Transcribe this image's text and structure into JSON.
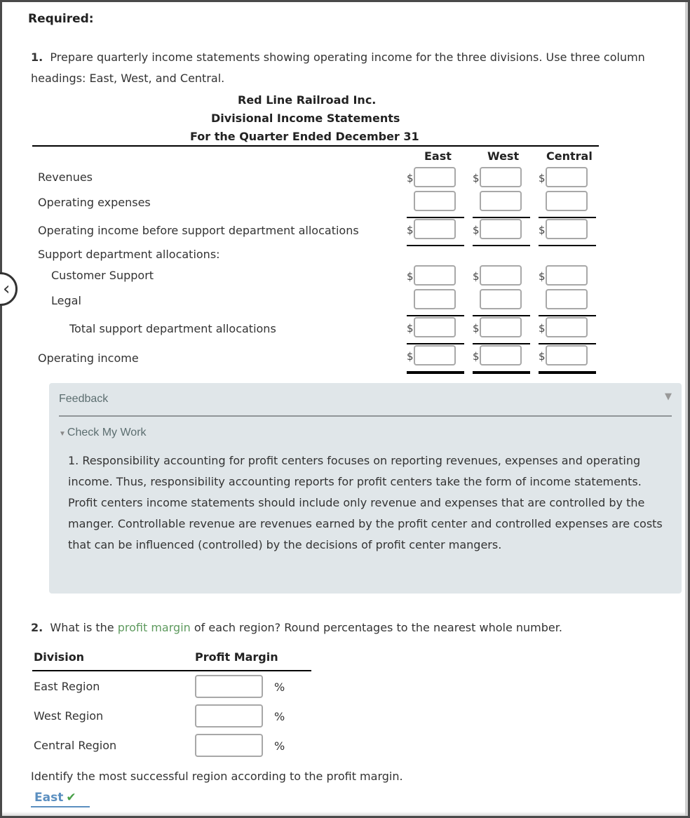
{
  "required_label": "Required:",
  "q1": {
    "number": "1.",
    "text": "Prepare quarterly income statements showing operating income for the three divisions. Use three column headings: East, West, and Central."
  },
  "statement": {
    "company": "Red Line Railroad Inc.",
    "title": "Divisional Income Statements",
    "period": "For the Quarter Ended December 31",
    "columns": [
      "East",
      "West",
      "Central"
    ],
    "currency_symbol": "$",
    "rows": [
      {
        "label": "Revenues",
        "values": [
          "",
          "",
          ""
        ]
      },
      {
        "label": "Operating expenses",
        "values": [
          "",
          "",
          ""
        ]
      },
      {
        "label": "Operating income before support department allocations",
        "values": [
          "",
          "",
          ""
        ]
      },
      {
        "label": "Support department allocations:"
      },
      {
        "label": "Customer Support",
        "values": [
          "",
          "",
          ""
        ]
      },
      {
        "label": "Legal",
        "values": [
          "",
          "",
          ""
        ]
      },
      {
        "label": "Total support department allocations",
        "values": [
          "",
          "",
          ""
        ]
      },
      {
        "label": "Operating income",
        "values": [
          "",
          "",
          ""
        ]
      }
    ]
  },
  "feedback": {
    "title": "Feedback",
    "check_my_work": "Check My Work",
    "text": "1. Responsibility accounting for profit centers focuses on reporting revenues, expenses and operating income. Thus, responsibility accounting reports for profit centers take the form of income statements. Profit centers income statements should include only revenue and expenses that are controlled by the manger. Controllable revenue are revenues earned by the profit center and controlled expenses are costs that can be influenced (controlled) by the decisions of profit center mangers."
  },
  "q2": {
    "number": "2.",
    "text_before": "What is the",
    "link": "profit margin",
    "text_after": "of each region? Round percentages to the nearest whole number.",
    "headers": [
      "Division",
      "Profit Margin"
    ],
    "rows": [
      {
        "label": "East Region",
        "value": "",
        "unit": "%"
      },
      {
        "label": "West Region",
        "value": "",
        "unit": "%"
      },
      {
        "label": "Central Region",
        "value": "",
        "unit": "%"
      }
    ],
    "identify_prompt": "Identify the most successful region according to the profit margin.",
    "selected_answer": "East",
    "answer_status": "correct"
  },
  "colors": {
    "feedback_bg": "#e0e6e9",
    "link_green": "#5e9a5e",
    "answer_blue": "#5b8fc0",
    "check_green": "#48a048"
  }
}
